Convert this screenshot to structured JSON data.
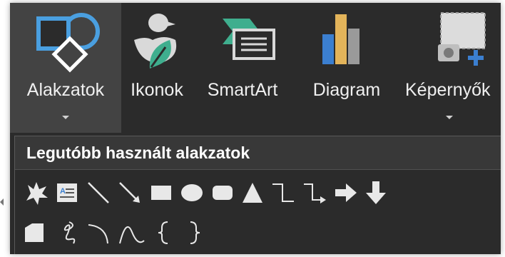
{
  "ribbon": {
    "buttons": [
      {
        "label": "Alakzatok",
        "icon": "shapes-icon",
        "has_dropdown": true,
        "active": true
      },
      {
        "label": "Ikonok",
        "icon": "icons-duck-leaf-icon",
        "has_dropdown": false,
        "active": false
      },
      {
        "label": "SmartArt",
        "icon": "smartart-icon",
        "has_dropdown": false,
        "active": false
      },
      {
        "label": "Diagram",
        "icon": "bar-chart-icon",
        "has_dropdown": false,
        "active": false
      },
      {
        "label": "Képernyők",
        "icon": "screenshot-icon",
        "has_dropdown": true,
        "active": false
      }
    ]
  },
  "shapes_panel": {
    "title": "Legutóbb használt alakzatok",
    "row1": [
      "explosion-icon",
      "text-box-icon",
      "line-icon",
      "arrow-line-icon",
      "rectangle-icon",
      "oval-icon",
      "rounded-rectangle-icon",
      "triangle-icon",
      "elbow-connector-icon",
      "elbow-arrow-connector-icon",
      "right-arrow-icon",
      "down-arrow-icon"
    ],
    "row2": [
      "snip-corner-rectangle-icon",
      "scribble-icon",
      "arc-icon",
      "curve-icon",
      "left-brace-icon",
      "right-brace-icon"
    ]
  },
  "colors": {
    "background": "#2b2b2b",
    "active_button": "#434343",
    "header": "#383838",
    "icon_blue": "#4a9fe0",
    "icon_teal": "#3fae8e",
    "bar_blue": "#3b7fd0",
    "bar_gold": "#e3b45a",
    "bar_gray": "#9a9a9a"
  }
}
